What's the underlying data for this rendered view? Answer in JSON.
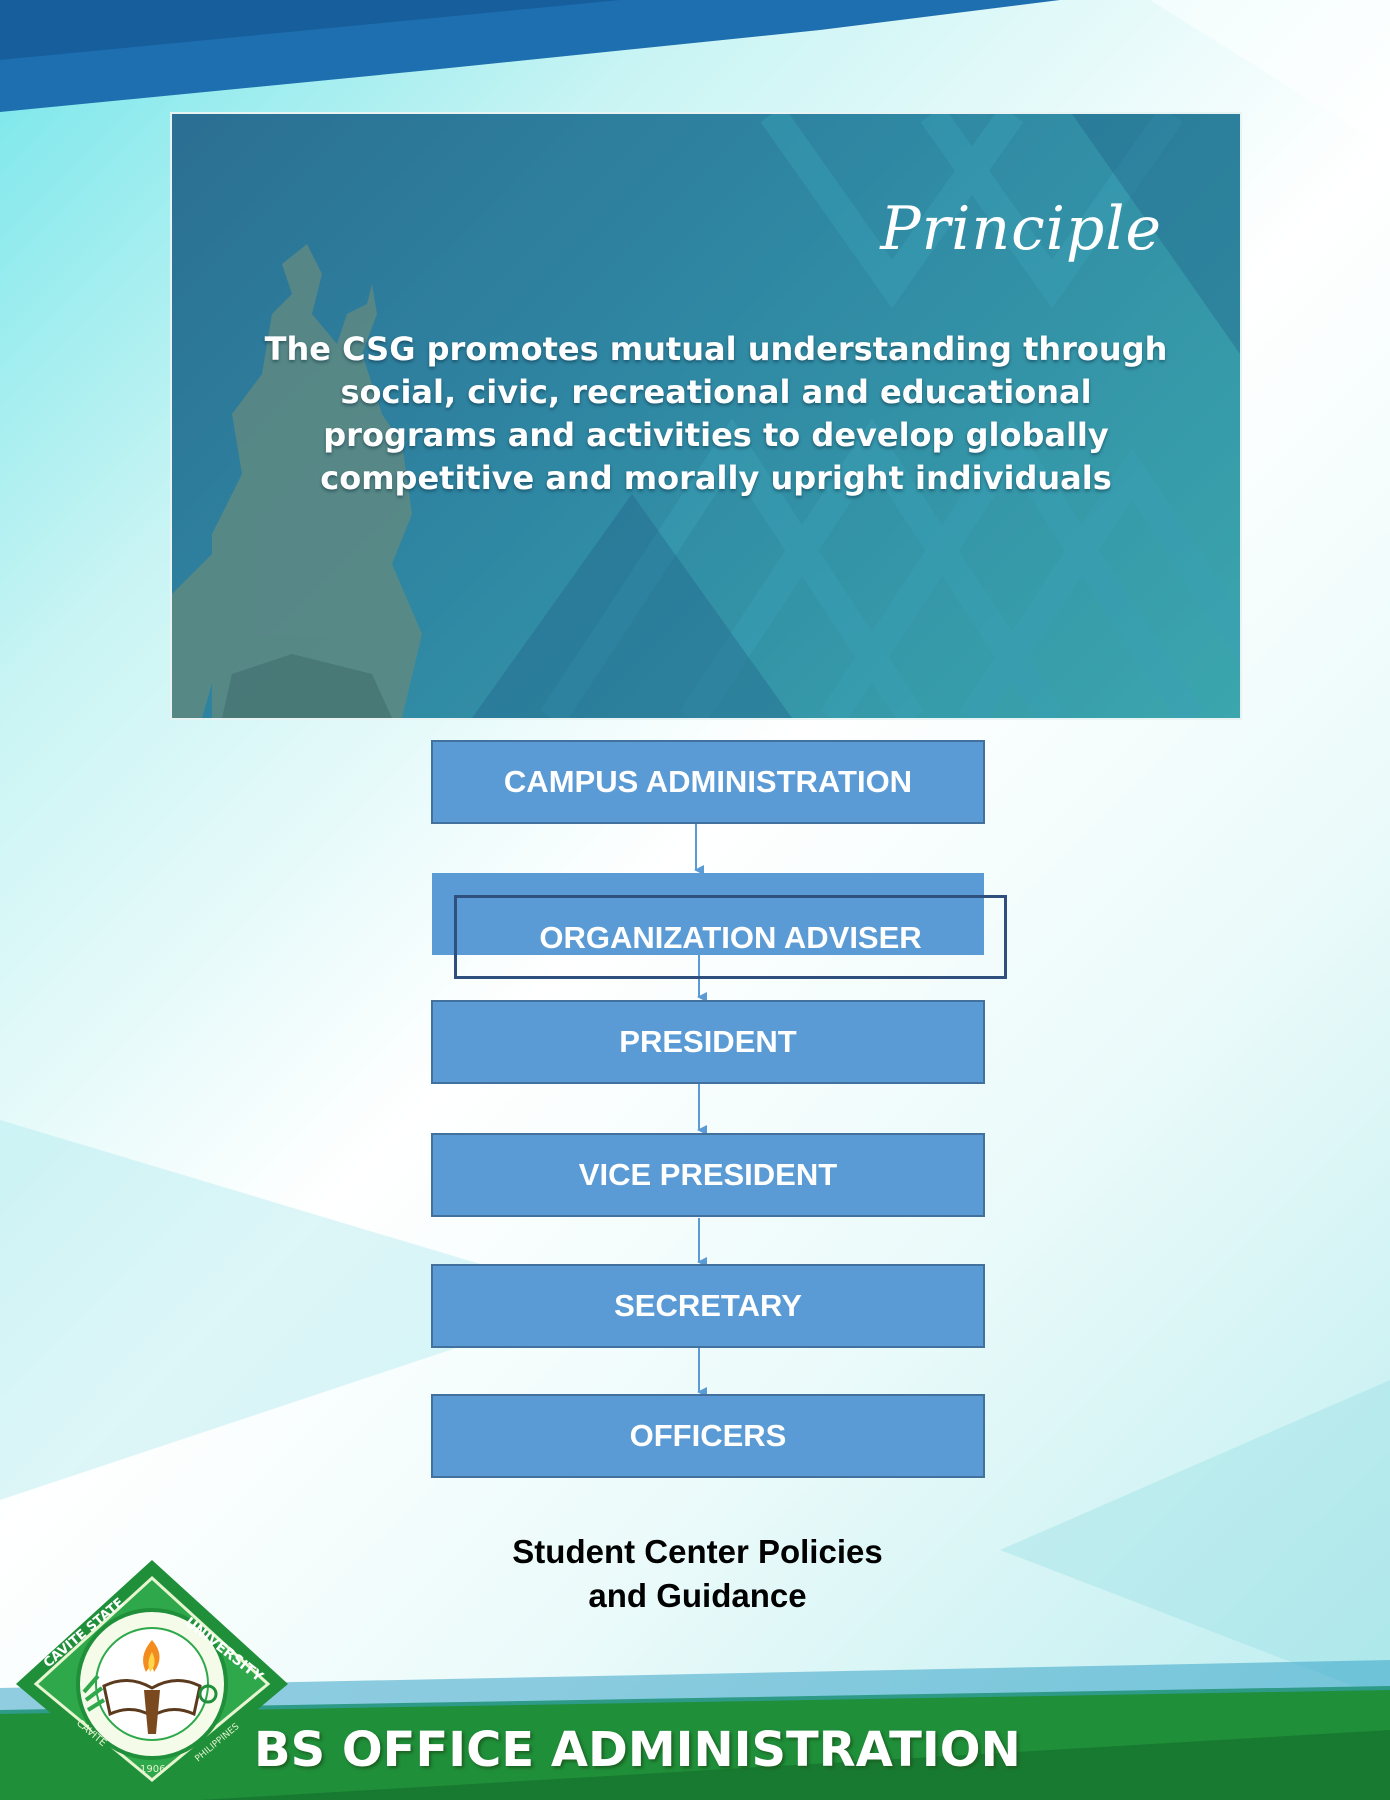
{
  "banner": {
    "title": "Principle",
    "text": "The CSG promotes mutual understanding through social, civic, recreational and educational programs and activities to develop globally competitive and morally upright individuals"
  },
  "org_chart": {
    "levels": [
      "CAMPUS ADMINISTRATION",
      "ORGANIZATION ADVISER",
      "PRESIDENT",
      "VICE PRESIDENT",
      "SECRETARY",
      "OFFICERS"
    ]
  },
  "caption": {
    "line1": "Student Center Policies",
    "line2": "and Guidance"
  },
  "seal": {
    "top_text": "UNIVERSITY",
    "left_text": "CAVITE STATE",
    "bottom_left": "CAVITE",
    "bottom_right": "PHILIPPINES",
    "year": "1906"
  },
  "program": {
    "title": "BS OFFICE ADMINISTRATION"
  },
  "colors": {
    "box_fill": "#5b9bd5",
    "box_border": "#41719c",
    "top_band": "#1e6fb0",
    "bottom_band": "#1f8f3a"
  }
}
